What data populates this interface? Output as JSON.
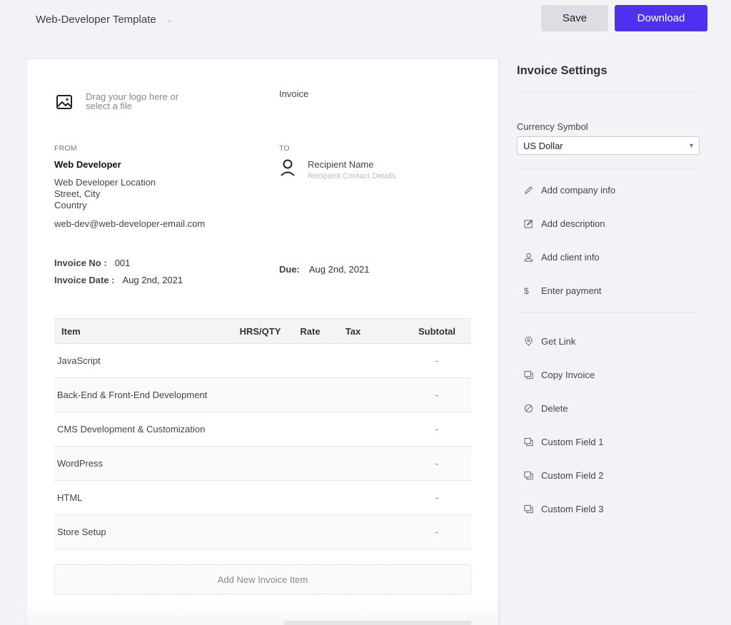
{
  "topbar": {
    "template_name": "Web-Developer Template",
    "save_label": "Save",
    "download_label": "Download",
    "accent_color": "#4e31ee"
  },
  "invoice": {
    "logo_prompt": "Drag your logo here or select a file",
    "title": "Invoice",
    "from": {
      "label": "FROM",
      "name": "Web Developer",
      "address_line1": "Web Developer Location",
      "address_line2": "Street, City",
      "address_line3": "Country",
      "email": "web-dev@web-developer-email.com"
    },
    "to": {
      "label": "TO",
      "name": "Recipient Name",
      "contact": "Recipient Contact Details"
    },
    "meta": {
      "number_label": "Invoice No :",
      "number": "001",
      "date_label": "Invoice Date :",
      "date": "Aug 2nd, 2021",
      "due_label": "Due:",
      "due": "Aug 2nd, 2021"
    },
    "table": {
      "headers": [
        "Item",
        "HRS/QTY",
        "Rate",
        "Tax",
        "Subtotal"
      ],
      "rows": [
        {
          "item": "JavaScript",
          "qty": "",
          "rate": "",
          "tax": "",
          "subtotal": "-"
        },
        {
          "item": "Back-End & Front-End Development",
          "qty": "",
          "rate": "",
          "tax": "",
          "subtotal": "-"
        },
        {
          "item": "CMS Development & Customization",
          "qty": "",
          "rate": "",
          "tax": "",
          "subtotal": "-"
        },
        {
          "item": "WordPress",
          "qty": "",
          "rate": "",
          "tax": "",
          "subtotal": "-"
        },
        {
          "item": "HTML",
          "qty": "",
          "rate": "",
          "tax": "",
          "subtotal": "-"
        },
        {
          "item": "Store Setup",
          "qty": "",
          "rate": "",
          "tax": "",
          "subtotal": "-"
        }
      ]
    },
    "add_item_label": "Add New Invoice Item"
  },
  "settings": {
    "title": "Invoice Settings",
    "currency_label": "Currency Symbol",
    "currency_value": "US Dollar",
    "actions": [
      {
        "label": "Add company info",
        "icon": "pencil-icon"
      },
      {
        "label": "Add description",
        "icon": "edit-box-icon"
      },
      {
        "label": "Add client info",
        "icon": "user-icon"
      },
      {
        "label": "Enter payment",
        "icon": "dollar-icon"
      }
    ],
    "tools": [
      {
        "label": "Get Link",
        "icon": "location-pin-icon"
      },
      {
        "label": "Copy Invoice",
        "icon": "copy-icon"
      },
      {
        "label": "Delete",
        "icon": "ban-icon"
      },
      {
        "label": "Custom Field 1",
        "icon": "copy-icon"
      },
      {
        "label": "Custom Field 2",
        "icon": "copy-icon"
      },
      {
        "label": "Custom Field 3",
        "icon": "copy-icon"
      }
    ]
  }
}
